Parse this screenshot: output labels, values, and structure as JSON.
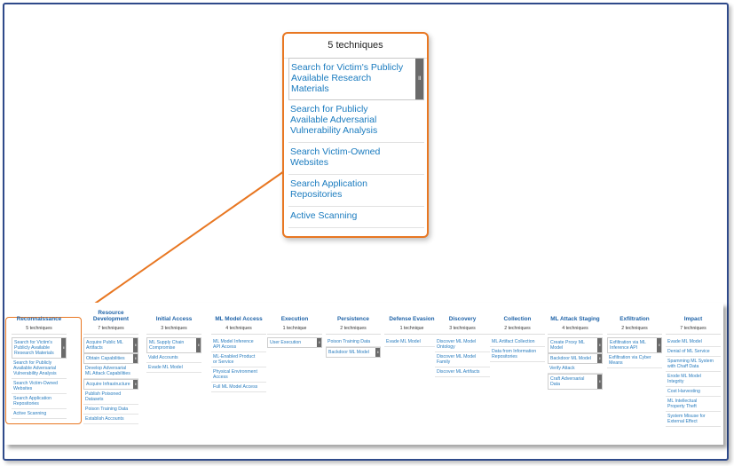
{
  "zoom": {
    "count_label": "5 techniques",
    "items": [
      {
        "label": "Search for Victim's Publicly Available Research Materials",
        "has_sub": true
      },
      {
        "label": "Search for Publicly Available Adversarial Vulnerability Analysis",
        "has_sub": false
      },
      {
        "label": "Search Victim-Owned Websites",
        "has_sub": false
      },
      {
        "label": "Search Application Repositories",
        "has_sub": false
      },
      {
        "label": "Active Scanning",
        "has_sub": false
      }
    ],
    "sub_glyph": "॥"
  },
  "colors": {
    "accent": "#e87722",
    "link": "#2a7dbf",
    "title": "#1f63a8",
    "frame": "#2f4a8a"
  },
  "tactics": [
    {
      "name": "Reconnaissance",
      "count": "5 techniques",
      "techniques": [
        {
          "label": "Search for Victim's Publicly Available Research Materials",
          "sub": true
        },
        {
          "label": "Search for Publicly Available Adversarial Vulnerability Analysis",
          "sub": false
        },
        {
          "label": "Search Victim-Owned Websites",
          "sub": false
        },
        {
          "label": "Search Application Repositories",
          "sub": false
        },
        {
          "label": "Active Scanning",
          "sub": false
        }
      ]
    },
    {
      "name": "Resource Development",
      "count": "7 techniques",
      "techniques": [
        {
          "label": "Acquire Public ML Artifacts",
          "sub": true
        },
        {
          "label": "Obtain Capabilities",
          "sub": true
        },
        {
          "label": "Develop Adversarial ML Attack Capabilities",
          "sub": false
        },
        {
          "label": "Acquire Infrastructure",
          "sub": true
        },
        {
          "label": "Publish Poisoned Datasets",
          "sub": false
        },
        {
          "label": "Poison Training Data",
          "sub": false
        },
        {
          "label": "Establish Accounts",
          "sub": false
        }
      ]
    },
    {
      "name": "Initial Access",
      "count": "3 techniques",
      "techniques": [
        {
          "label": "ML Supply Chain Compromise",
          "sub": true
        },
        {
          "label": "Valid Accounts",
          "sub": false
        },
        {
          "label": "Evade ML Model",
          "sub": false
        }
      ]
    },
    {
      "name": "ML Model Access",
      "count": "4 techniques",
      "techniques": [
        {
          "label": "ML Model Inference API Access",
          "sub": false
        },
        {
          "label": "ML-Enabled Product or Service",
          "sub": false
        },
        {
          "label": "Physical Environment Access",
          "sub": false
        },
        {
          "label": "Full ML Model Access",
          "sub": false
        }
      ]
    },
    {
      "name": "Execution",
      "count": "1 technique",
      "techniques": [
        {
          "label": "User Execution",
          "sub": true
        }
      ]
    },
    {
      "name": "Persistence",
      "count": "2 techniques",
      "techniques": [
        {
          "label": "Poison Training Data",
          "sub": false
        },
        {
          "label": "Backdoor ML Model",
          "sub": true
        }
      ]
    },
    {
      "name": "Defense Evasion",
      "count": "1 technique",
      "techniques": [
        {
          "label": "Evade ML Model",
          "sub": false
        }
      ]
    },
    {
      "name": "Discovery",
      "count": "3 techniques",
      "techniques": [
        {
          "label": "Discover ML Model Ontology",
          "sub": false
        },
        {
          "label": "Discover ML Model Family",
          "sub": false
        },
        {
          "label": "Discover ML Artifacts",
          "sub": false
        }
      ]
    },
    {
      "name": "Collection",
      "count": "2 techniques",
      "techniques": [
        {
          "label": "ML Artifact Collection",
          "sub": false
        },
        {
          "label": "Data from Information Repositories",
          "sub": false
        }
      ]
    },
    {
      "name": "ML Attack Staging",
      "count": "4 techniques",
      "techniques": [
        {
          "label": "Create Proxy ML Model",
          "sub": true
        },
        {
          "label": "Backdoor ML Model",
          "sub": true
        },
        {
          "label": "Verify Attack",
          "sub": false
        },
        {
          "label": "Craft Adversarial Data",
          "sub": true
        }
      ]
    },
    {
      "name": "Exfiltration",
      "count": "2 techniques",
      "techniques": [
        {
          "label": "Exfiltration via ML Inference API",
          "sub": true
        },
        {
          "label": "Exfiltration via Cyber Means",
          "sub": false
        }
      ]
    },
    {
      "name": "Impact",
      "count": "7 techniques",
      "techniques": [
        {
          "label": "Evade ML Model",
          "sub": false
        },
        {
          "label": "Denial of ML Service",
          "sub": false
        },
        {
          "label": "Spamming ML System with Chaff Data",
          "sub": false
        },
        {
          "label": "Erode ML Model Integrity",
          "sub": false
        },
        {
          "label": "Cost Harvesting",
          "sub": false
        },
        {
          "label": "ML Intellectual Property Theft",
          "sub": false
        },
        {
          "label": "System Misuse for External Effect",
          "sub": false
        }
      ]
    }
  ]
}
